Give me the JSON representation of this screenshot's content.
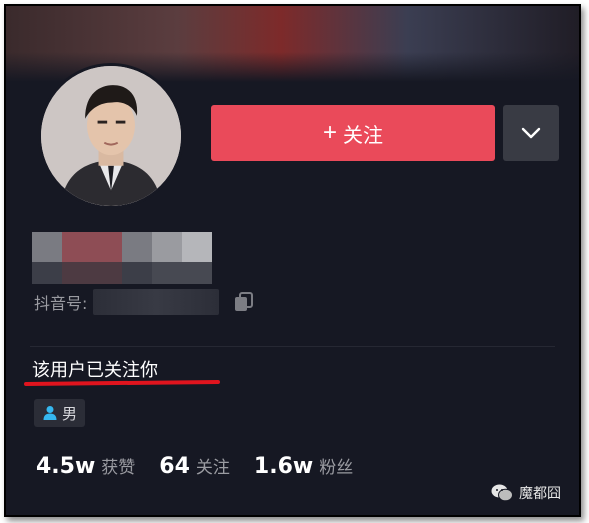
{
  "profile": {
    "follow_button_label": "关注",
    "follow_button_icon": "plus-icon",
    "more_button_icon": "chevron-down-icon",
    "id_label": "抖音号:",
    "follows_you_text": "该用户已关注你",
    "gender": "男",
    "gender_icon": "person-icon"
  },
  "stats": [
    {
      "value": "4.5w",
      "label": "获赞"
    },
    {
      "value": "64",
      "label": "关注"
    },
    {
      "value": "1.6w",
      "label": "粉丝"
    }
  ],
  "watermark": {
    "text": "魔都囧",
    "icon": "wechat-icon"
  },
  "colors": {
    "background": "#161823",
    "follow_button": "#ea4a5a",
    "more_button": "#393b44",
    "annotation_underline": "#e0141e",
    "secondary_text": "#9a9ba1"
  }
}
